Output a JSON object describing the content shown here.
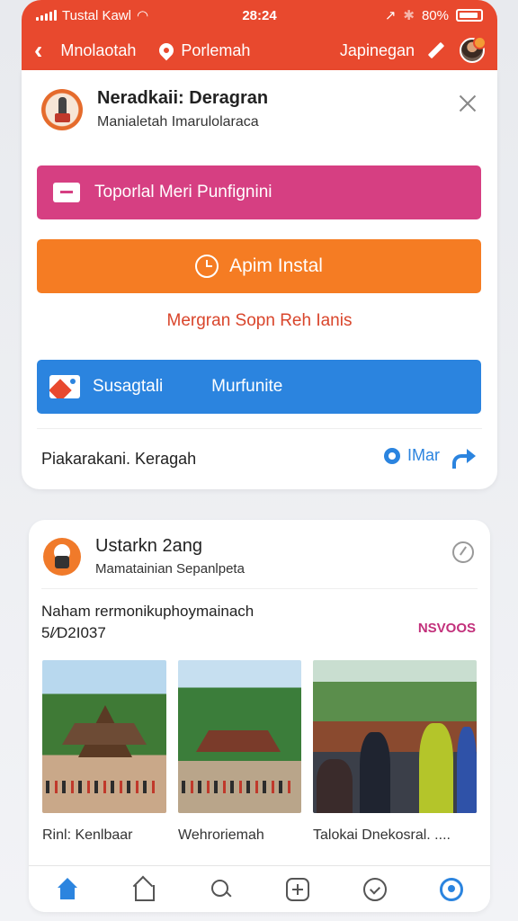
{
  "status_bar": {
    "carrier": "Tustal Kawl",
    "time": "28:24",
    "battery": "80%"
  },
  "app_bar": {
    "nav_a": "Mnolaotah",
    "nav_b": "Porlemah",
    "nav_c": "Japinegan"
  },
  "card1": {
    "title": "Neradkaii: Deragran",
    "subtitle": "Manialetah  Imarulolaraca",
    "pink_button": "Toporlal  Meri Punfignini",
    "orange_button": "Apim Instal",
    "red_link": "Mergran Sopn Reh Ianis",
    "blue_button_left": "Susagtali",
    "blue_button_right": "Murfunite",
    "footer_left": "Piakarakani. Keragah",
    "footer_right": "IMar"
  },
  "card2": {
    "title": "Ustarkn 2ang",
    "subtitle": "Mamatainian Sepanlpeta",
    "text_line1": "Naham rermonikuphoymainach",
    "text_line2": "5/⁄D2I037",
    "tag": "NSVOOS",
    "thumbs": [
      {
        "label": "Rinl: Kenlbaar"
      },
      {
        "label": "Wehroriemah"
      },
      {
        "label": "Talokai Dnekosral. ...."
      }
    ]
  },
  "colors": {
    "header": "#e8492e",
    "pink": "#d63f82",
    "orange": "#f57c23",
    "blue": "#2b84df",
    "link_red": "#d9452b",
    "tag": "#c2307b"
  },
  "icons": [
    "signal-icon",
    "wifi-icon",
    "location-arrow-icon",
    "bluetooth-icon",
    "battery-icon",
    "back-arrow-icon",
    "pin-icon",
    "pencil-icon",
    "avatar",
    "close-icon",
    "folder-icon",
    "clock-icon",
    "image-icon",
    "dot-icon",
    "share-icon",
    "compass-icon",
    "home-icon",
    "house-icon",
    "search-icon",
    "add-icon",
    "check-icon",
    "profile-icon"
  ]
}
